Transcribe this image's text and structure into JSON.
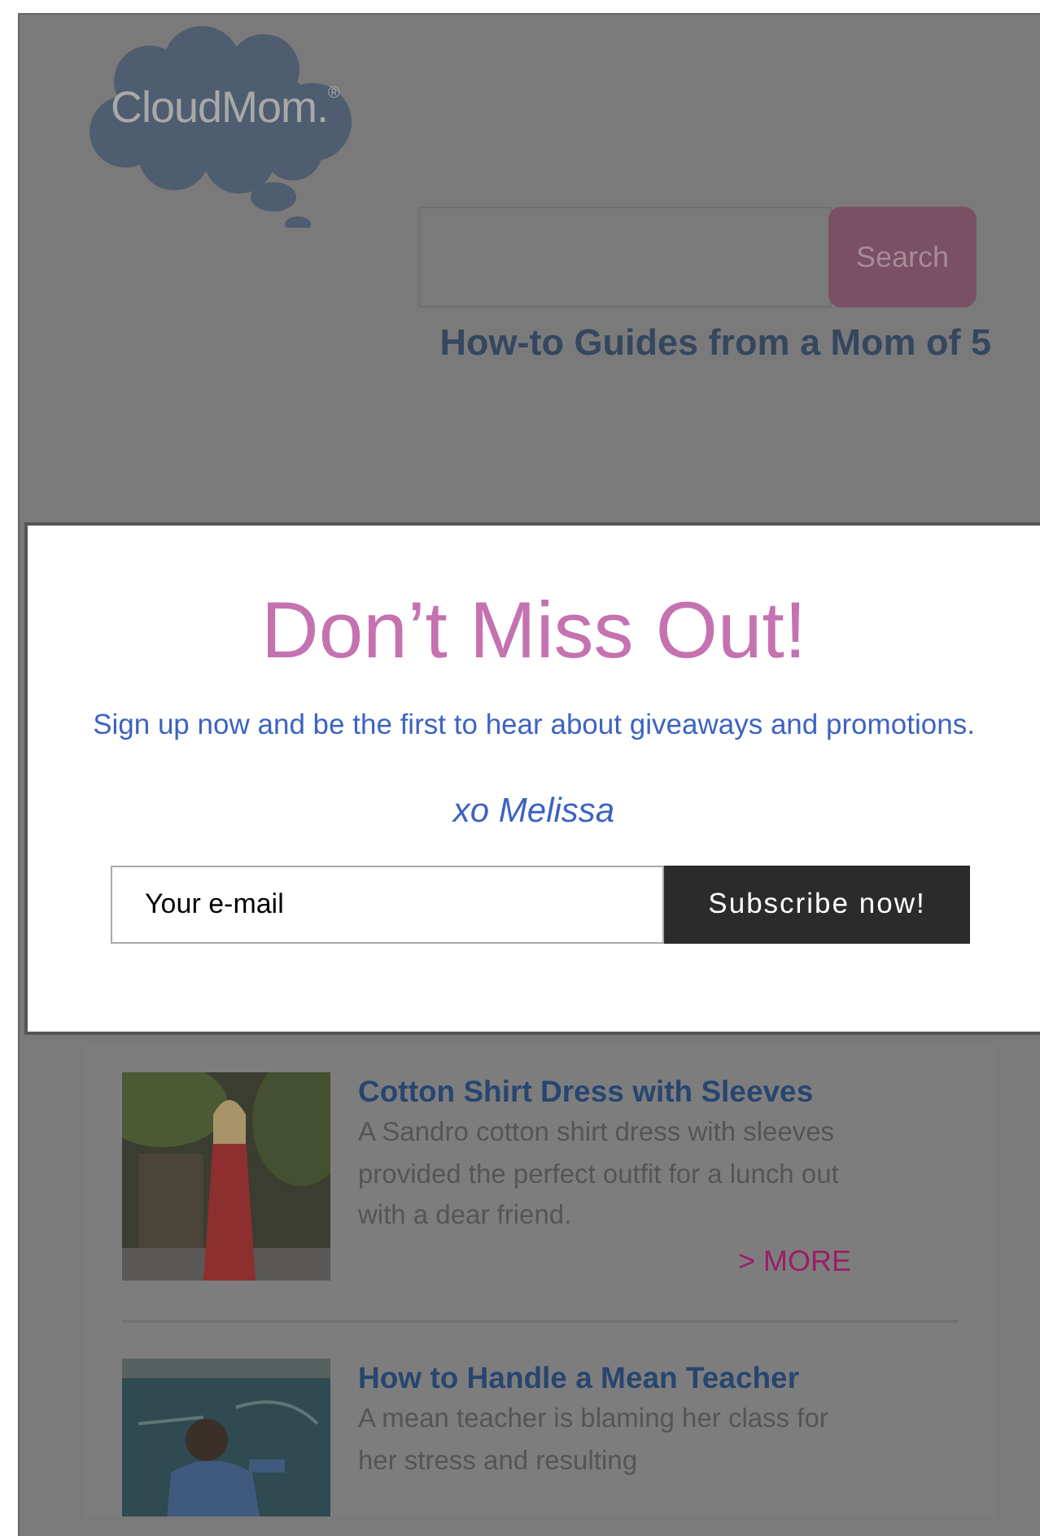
{
  "header": {
    "logo": "CloudMom.$^{®}$",
    "search": {
      "button": "Search"
    },
    "tagline": "How-to Guides from a Mom of 5"
  },
  "popup": {
    "title": "Don’t Miss Out!",
    "message": "Sign up now and be the first to hear about giveaways and promotions.",
    "signature": "xo Melissa",
    "email": {
      "placeholder": "Your e-mail"
    },
    "button": "Subscribe now!"
  },
  "posts": [
    {
      "title": "Cotton Shirt Dress with Sleeves",
      "excerpt": "A Sandro cotton shirt dress with sleeves provided the perfect outfit for a lunch out with a dear friend.",
      "more": "> MORE"
    },
    {
      "title": "How to Handle a Mean Teacher",
      "excerpt": "A mean teacher is blaming her class for her stress and resulting"
    }
  ]
}
